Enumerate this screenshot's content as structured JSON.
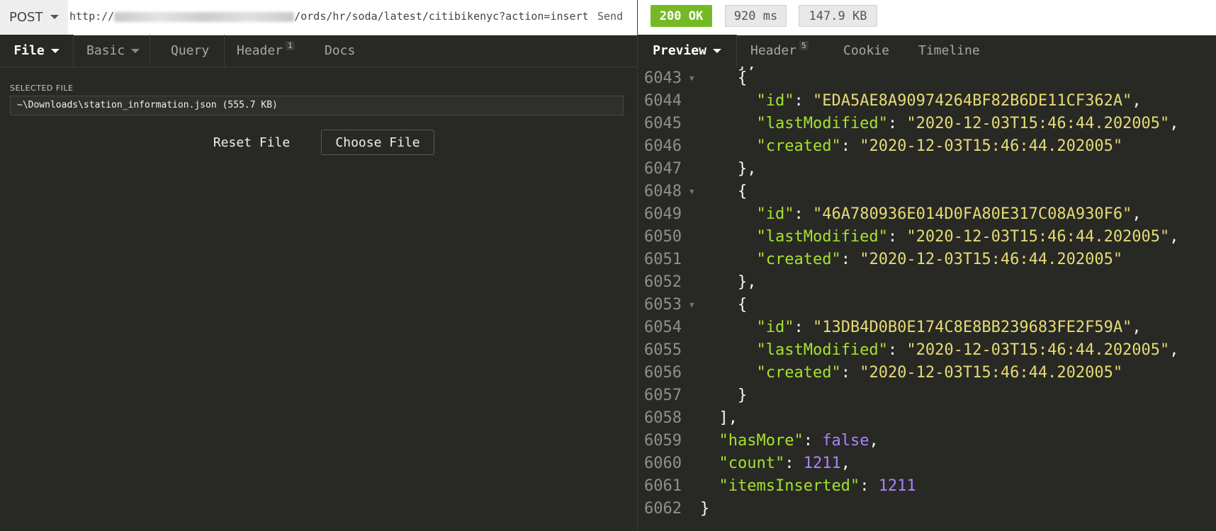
{
  "request": {
    "method": "POST",
    "url_prefix": "http://",
    "url_suffix": "/ords/hr/soda/latest/citibikenyc?action=insert",
    "send_label": "Send"
  },
  "left_tabs": {
    "file": "File",
    "basic": "Basic",
    "query": "Query",
    "header": "Header",
    "header_badge": "1",
    "docs": "Docs"
  },
  "file_panel": {
    "selected_label": "SELECTED FILE",
    "file_value": "~\\Downloads\\station_information.json (555.7 KB)",
    "reset_label": "Reset File",
    "choose_label": "Choose File"
  },
  "response": {
    "status": "200 OK",
    "time": "920 ms",
    "size": "147.9 KB",
    "status_color": "#75ba24"
  },
  "right_tabs": {
    "preview": "Preview",
    "header": "Header",
    "header_badge": "5",
    "cookie": "Cookie",
    "timeline": "Timeline"
  },
  "code_lines": [
    {
      "n": "6043",
      "fold": true,
      "text": "    {"
    },
    {
      "n": "6044",
      "text": "      \"id\": \"EDA5AE8A90974264BF82B6DE11CF362A\","
    },
    {
      "n": "6045",
      "text": "      \"lastModified\": \"2020-12-03T15:46:44.202005\","
    },
    {
      "n": "6046",
      "text": "      \"created\": \"2020-12-03T15:46:44.202005\""
    },
    {
      "n": "6047",
      "text": "    },"
    },
    {
      "n": "6048",
      "fold": true,
      "text": "    {"
    },
    {
      "n": "6049",
      "text": "      \"id\": \"46A780936E014D0FA80E317C08A930F6\","
    },
    {
      "n": "6050",
      "text": "      \"lastModified\": \"2020-12-03T15:46:44.202005\","
    },
    {
      "n": "6051",
      "text": "      \"created\": \"2020-12-03T15:46:44.202005\""
    },
    {
      "n": "6052",
      "text": "    },"
    },
    {
      "n": "6053",
      "fold": true,
      "text": "    {"
    },
    {
      "n": "6054",
      "text": "      \"id\": \"13DB4D0B0E174C8E8BB239683FE2F59A\","
    },
    {
      "n": "6055",
      "text": "      \"lastModified\": \"2020-12-03T15:46:44.202005\","
    },
    {
      "n": "6056",
      "text": "      \"created\": \"2020-12-03T15:46:44.202005\""
    },
    {
      "n": "6057",
      "text": "    }"
    },
    {
      "n": "6058",
      "text": "  ],"
    },
    {
      "n": "6059",
      "text": "  \"hasMore\": false,"
    },
    {
      "n": "6060",
      "text": "  \"count\": 1211,"
    },
    {
      "n": "6061",
      "text": "  \"itemsInserted\": 1211"
    },
    {
      "n": "6062",
      "text": "}"
    }
  ]
}
